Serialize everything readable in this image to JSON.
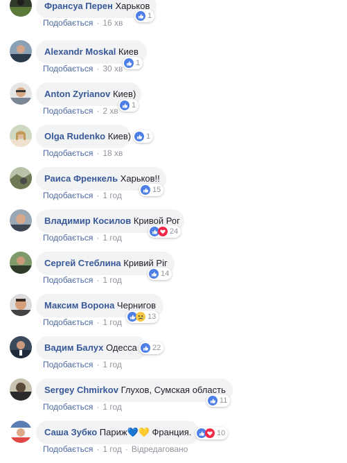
{
  "like_label": "Подобається",
  "edited_label": "Відредаговано",
  "comments": [
    {
      "author": "Франсуа Перен",
      "text": "Харьков",
      "time": "16 хв",
      "count": "1",
      "reactions": [
        "like"
      ]
    },
    {
      "author": "Alexandr Moskal",
      "text": "Киев",
      "time": "30 хв",
      "count": "1",
      "reactions": [
        "like"
      ]
    },
    {
      "author": "Anton Zyrianov",
      "text": "Киев)",
      "time": "2 хв",
      "count": "1",
      "reactions": [
        "like"
      ]
    },
    {
      "author": "Olga Rudenko",
      "text": "Киев)",
      "time": "18 хв",
      "count": "1",
      "reactions": [
        "like"
      ]
    },
    {
      "author": "Раиса Френкель",
      "text": "Харьков!!",
      "time": "1 год",
      "count": "15",
      "reactions": [
        "like"
      ]
    },
    {
      "author": "Владимир Косилов",
      "text": "Кривой Рог",
      "time": "1 год",
      "count": "24",
      "reactions": [
        "like",
        "love"
      ]
    },
    {
      "author": "Сергей Стеблина",
      "text": "Кривий Ріг",
      "time": "1 год",
      "count": "14",
      "reactions": [
        "like"
      ]
    },
    {
      "author": "Максим Ворона",
      "text": "Чернигов",
      "time": "1 год",
      "count": "13",
      "reactions": [
        "like",
        "sad"
      ]
    },
    {
      "author": "Вадим Балух",
      "text": "Одесса",
      "time": "1 год",
      "count": "22",
      "reactions": [
        "like"
      ]
    },
    {
      "author": "Sergey Chmirkov",
      "text": "Глухов, Сумская область",
      "time": "1 год",
      "count": "11",
      "reactions": [
        "like"
      ]
    },
    {
      "author": "Саша Зубко",
      "text": "Париж💙💛 Франция.",
      "time": "1 год",
      "count": "10",
      "reactions": [
        "like",
        "love"
      ],
      "edited": true
    }
  ]
}
